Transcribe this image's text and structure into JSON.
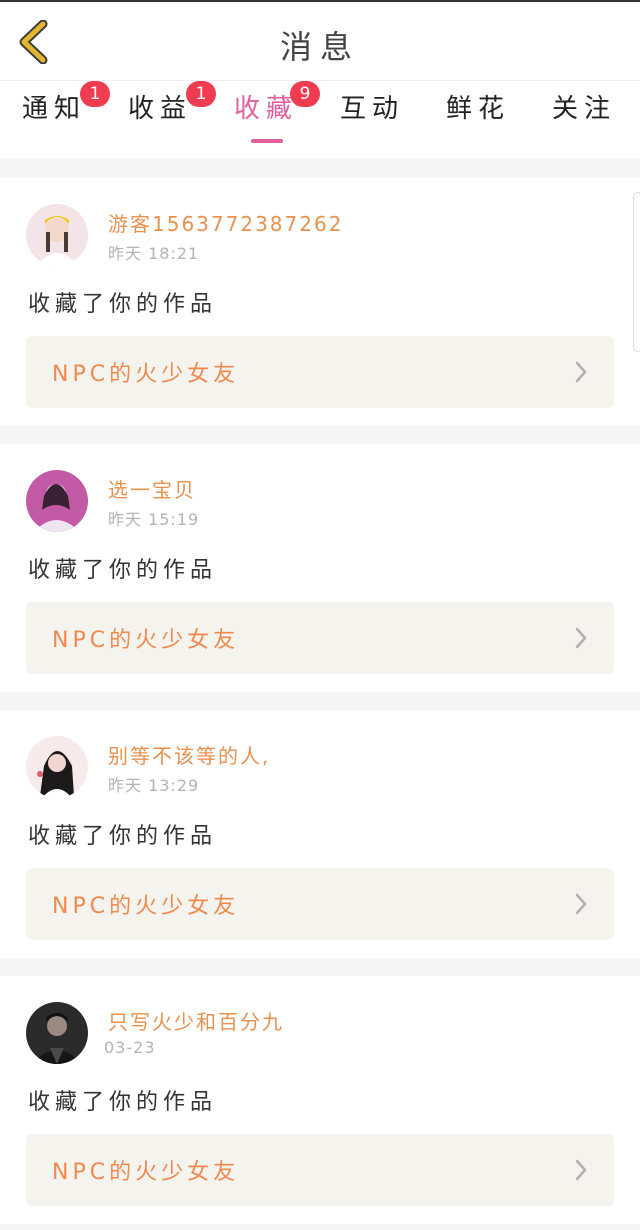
{
  "header": {
    "title": "消息"
  },
  "tabs": [
    {
      "label": "通知",
      "badge": "1"
    },
    {
      "label": "收益",
      "badge": "1"
    },
    {
      "label": "收藏",
      "badge": "9",
      "active": true
    },
    {
      "label": "互动"
    },
    {
      "label": "鲜花"
    },
    {
      "label": "关注"
    }
  ],
  "notifications": [
    {
      "user": "游客1563772387262",
      "time": "昨天 18:21",
      "action": "收藏了你的作品",
      "work": "NPC的火少女友"
    },
    {
      "user": "选一宝贝",
      "time": "昨天 15:19",
      "action": "收藏了你的作品",
      "work": "NPC的火少女友"
    },
    {
      "user": "别等不该等的人,",
      "time": "昨天 13:29",
      "action": "收藏了你的作品",
      "work": "NPC的火少女友"
    },
    {
      "user": "只写火少和百分九",
      "time": "03-23",
      "action": "收藏了你的作品",
      "work": "NPC的火少女友"
    }
  ],
  "colors": {
    "accent": "#e0609b",
    "username": "#e8914f",
    "badge": "#f03c50",
    "back": "#e2b62e"
  },
  "icons": {
    "back": "chevron-left-icon",
    "item": "chevron-right-icon"
  }
}
